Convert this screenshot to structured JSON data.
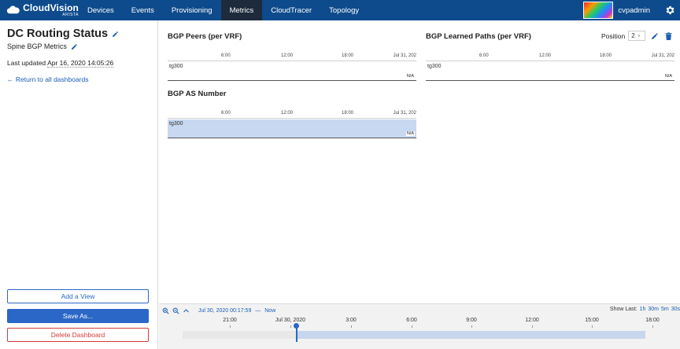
{
  "topnav": {
    "brand": "CloudVision",
    "brand_sub": "ARISTA",
    "items": [
      {
        "label": "Devices"
      },
      {
        "label": "Events"
      },
      {
        "label": "Provisioning"
      },
      {
        "label": "Metrics",
        "active": true
      },
      {
        "label": "CloudTracer"
      },
      {
        "label": "Topology"
      }
    ],
    "username": "cvpadmin",
    "accent_color": "#0e4b8c"
  },
  "sidebar": {
    "title": "DC Routing Status",
    "subtitle": "Spine BGP Metrics",
    "last_updated_label": "Last updated",
    "last_updated_value": "Apr 16, 2020 14:05:26",
    "return_link": "Return to all dashboards",
    "add_view": "Add a View",
    "save_as": "Save As...",
    "delete": "Delete Dashboard"
  },
  "widgets": {
    "bgp_peers": {
      "title": "BGP Peers (per VRF)",
      "ticks": [
        "6:00",
        "12:00",
        "18:00",
        "Jul 31, 202"
      ],
      "row_label": "tg300",
      "row_value": "N/A"
    },
    "bgp_paths": {
      "title": "BGP Learned Paths (per VRF)",
      "ticks": [
        "6:00",
        "12:00",
        "18:00",
        "Jul 31, 202"
      ],
      "row_label": "tg300",
      "row_value": "N/A",
      "position_label": "Position",
      "position_value": "2"
    },
    "bgp_as": {
      "title": "BGP AS Number",
      "ticks": [
        "6:00",
        "12:00",
        "18:00",
        "Jul 31, 202"
      ],
      "row_label": "tg300",
      "row_value": "N/A"
    }
  },
  "timeline": {
    "range_start": "Jul 30, 2020 00:17:59",
    "range_sep": "—",
    "range_end": "Now",
    "show_last_label": "Show Last:",
    "show_last_options": [
      "1h",
      "30m",
      "5m",
      "30s"
    ],
    "ticks": [
      "21:00",
      "Jul 30, 2020",
      "3:00",
      "6:00",
      "9:00",
      "12:00",
      "15:00",
      "18:00"
    ]
  }
}
